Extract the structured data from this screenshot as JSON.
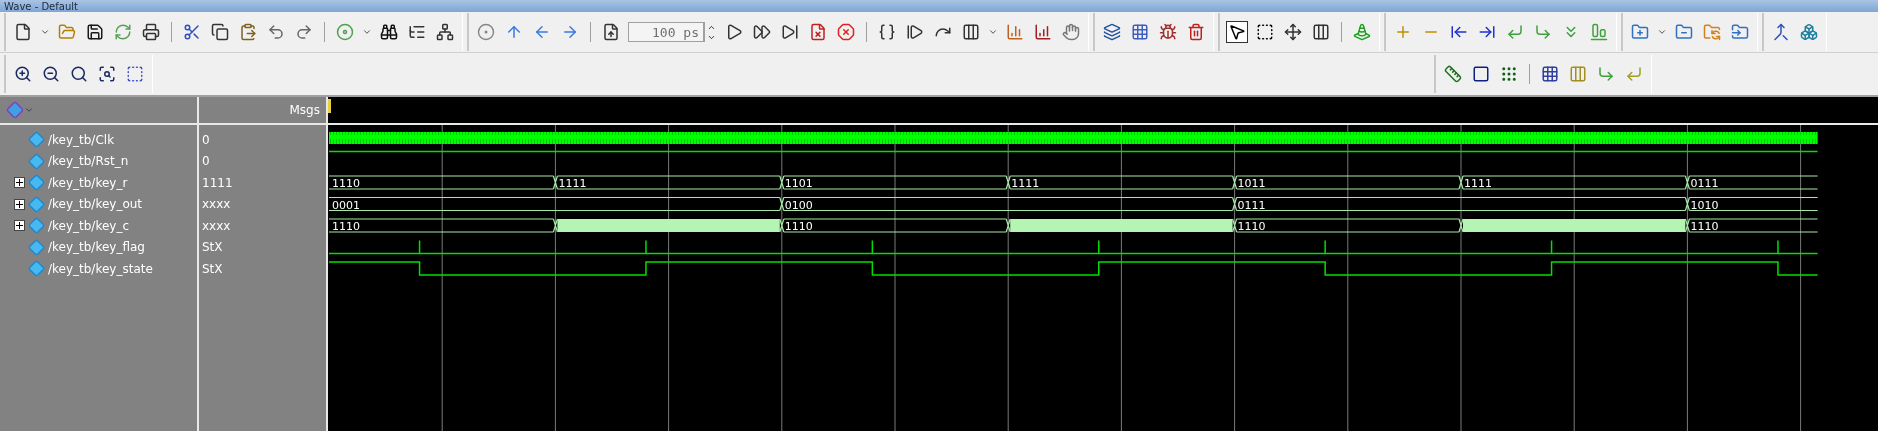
{
  "window": {
    "title": "Wave - Default"
  },
  "toolbar": {
    "run_length": "100 ps",
    "pointer_tool": {
      "selected": true
    }
  },
  "wave": {
    "messages_label": "Msgs",
    "signals": [
      {
        "name": "/key_tb/Clk",
        "value": "0",
        "kind": "clock"
      },
      {
        "name": "/key_tb/Rst_n",
        "value": "0",
        "kind": "high"
      },
      {
        "name": "/key_tb/key_r",
        "value": "1111",
        "kind": "bus",
        "expanded": false,
        "segments": [
          {
            "label": "1110",
            "kind": "value"
          },
          {
            "label": "1111",
            "kind": "value"
          },
          {
            "label": "1101",
            "kind": "value"
          },
          {
            "label": "1111",
            "kind": "value"
          },
          {
            "label": "1011",
            "kind": "value"
          },
          {
            "label": "1111",
            "kind": "value"
          },
          {
            "label": "0111",
            "kind": "value"
          }
        ]
      },
      {
        "name": "/key_tb/key_out",
        "value": "xxxx",
        "kind": "bus",
        "expanded": false,
        "segments": [
          {
            "label": "0001",
            "kind": "value"
          },
          {
            "label": "0100",
            "kind": "value"
          },
          {
            "label": "0111",
            "kind": "value"
          },
          {
            "label": "1010",
            "kind": "value"
          }
        ]
      },
      {
        "name": "/key_tb/key_c",
        "value": "xxxx",
        "kind": "bus",
        "expanded": false,
        "segments": [
          {
            "label": "1110",
            "kind": "value"
          },
          {
            "kind": "filled"
          },
          {
            "label": "1110",
            "kind": "value"
          },
          {
            "kind": "filled"
          },
          {
            "label": "1110",
            "kind": "value"
          },
          {
            "kind": "filled"
          },
          {
            "label": "1110",
            "kind": "value"
          }
        ]
      },
      {
        "name": "/key_tb/key_flag",
        "value": "StX",
        "kind": "pulse"
      },
      {
        "name": "/key_tb/key_state",
        "value": "StX",
        "kind": "toggle"
      }
    ]
  }
}
